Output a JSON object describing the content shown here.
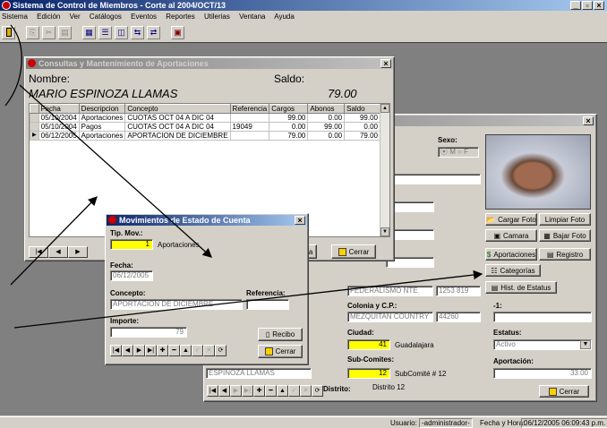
{
  "app": {
    "title": "Sistema de Control de Miembros - Corte al 2004/OCT/13",
    "controls": "_  ̲×",
    "controls_text": "_ □ ×"
  },
  "menu": [
    "Sistema",
    "Edición",
    "Ver",
    "Catálogos",
    "Eventos",
    "Reportes",
    "Utilerias",
    "Ventana",
    "Ayuda"
  ],
  "status": {
    "user_label": "Usuario:",
    "user_value": "-administrador-",
    "date_label": "Fecha y Hora:",
    "date_value": "06/12/2005 06:09:43 p.m."
  },
  "consultas": {
    "title": "Consultas y Mantenimiento de Aportaciones",
    "nombre_label": "Nombre:",
    "nombre_value": "MARIO ESPINOZA LLAMAS",
    "saldo_label": "Saldo:",
    "saldo_value": "79.00",
    "columns": [
      "Fecha",
      "Descripcion",
      "Concepto",
      "Referencia",
      "Cargos",
      "Abonos",
      "Saldo"
    ],
    "rows": [
      [
        "05/10/2004",
        "Aportaciones",
        "CUOTAS OCT 04 A DIC 04",
        "",
        "99.00",
        "0.00",
        "99.00"
      ],
      [
        "05/10/2004",
        "Pagos",
        "CUOTAS OCT 04 A DIC 04",
        "19049",
        "0.00",
        "99.00",
        "0.00"
      ],
      [
        "06/12/2005",
        "Aportaciones",
        "APORTACION DE DICIEMBRE",
        "",
        "79.00",
        "0.00",
        "79.00"
      ]
    ],
    "cerrar": "Cerrar",
    "partial_btn": "ta"
  },
  "movimientos": {
    "title": "Movimientos de Estado de Cuenta",
    "tip_label": "Tip. Mov.:",
    "tip_value": "1",
    "tip_desc": "Aportaciones",
    "fecha_label": "Fecha:",
    "fecha_value": "06/12/2005",
    "concepto_label": "Concepto:",
    "concepto_value": "APORTACION DE DICIEMBRE",
    "referencia_label": "Referencia:",
    "referencia_value": "",
    "importe_label": "Importe:",
    "importe_value": "79",
    "recibo": "Recibo",
    "cerrar": "Cerrar"
  },
  "miembro": {
    "sexo_label": "Sexo:",
    "sexo_value": "⦿ M ○ F",
    "partial_label": "o:",
    "calle_value": "FEDERALISMO NTE",
    "num_value": "1253 819",
    "colonia_label": "Colonia y C.P.:",
    "colonia_value": "MEZQUITAN COUNTRY",
    "cp_value": "44260",
    "ciudad_label": "Ciudad:",
    "ciudad_code": "41",
    "ciudad_name": "Guadalajara",
    "subcomites_label": "Sub-Comites:",
    "subcomite_code": "12",
    "subcomite_name": "SubComité # 12",
    "nombre_bottom": "ESPINOZA LLAMAS",
    "distrito_label": "Distrito:",
    "distrito_value": "Distrito 12",
    "minus1_label": "-1:",
    "estatus_label": "Estatus:",
    "estatus_value": "Activo",
    "aportacion_label": "Aportación:",
    "aportacion_value": "33.00",
    "cargar_foto": "Cargar Foto",
    "limpiar_foto": "Limpiar Foto",
    "camara": "Camara",
    "bajar_foto": "Bajar Foto",
    "aportaciones": "Aportaciones",
    "registro": "Registro",
    "categorias": "Categorías",
    "hist_estatus": "Hist. de Estatus",
    "cerrar": "Cerrar"
  }
}
